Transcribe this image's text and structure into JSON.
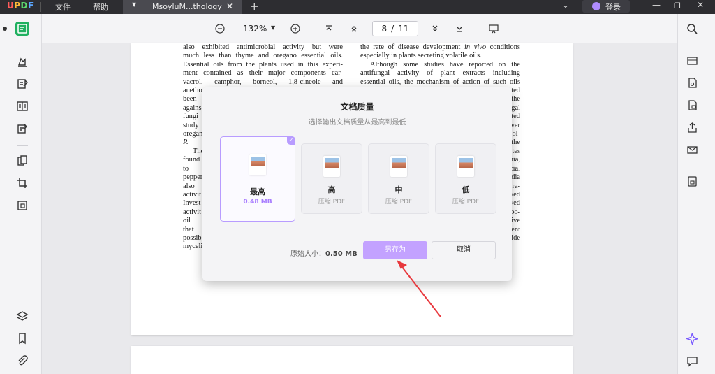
{
  "app": {
    "logo": "UPDF",
    "menu": [
      "文件",
      "帮助"
    ],
    "tab_name": "MsoyluM...thology",
    "login_label": "登录"
  },
  "toolbar": {
    "zoom": "132%",
    "current_page": "8",
    "page_separator": "/",
    "total_pages": "11"
  },
  "document": {
    "left_column": [
      "also exhibited antimicrobial activity but were",
      "much less than thyme and oregano essential oils.",
      "Essential oils from the plants used in this experi-",
      "ment contained as their major components car-",
      "vacrol, camphor, borneol, 1,8-cineole and",
      "anetho",
      "been",
      "agains",
      "fungi a",
      "study",
      "oregan",
      "P. infe",
      "The",
      "found",
      "to the",
      "pepper",
      "also",
      "activit",
      "Invest",
      "activit",
      "oil va",
      "that th",
      "possib",
      "myceli"
    ],
    "right_column": [
      "the rate of disease development in vivo conditions",
      "especially in plants secreting volatile oils.",
      "Although some studies have reported on the",
      "antifungal activity of plant extracts including",
      "essential oils, the mechanism of action of such oils",
      "ted",
      "the",
      "gal",
      "ted",
      "ver",
      "ol-",
      "the",
      "tes",
      "nia,",
      "cial",
      "dia",
      "ra-",
      "ved",
      "ved",
      "bo-",
      "ive",
      "ent",
      "ide"
    ]
  },
  "dialog": {
    "title": "文档质量",
    "subtitle": "选择输出文档质量从最高到最低",
    "options": [
      {
        "label": "最高",
        "size": "0.48 MB",
        "selected": true
      },
      {
        "label": "高",
        "size": "压缩 PDF",
        "selected": false
      },
      {
        "label": "中",
        "size": "压缩 PDF",
        "selected": false
      },
      {
        "label": "低",
        "size": "压缩 PDF",
        "selected": false
      }
    ],
    "original_size_label": "原始大小：",
    "original_size_value": "0.50 MB",
    "save_as_label": "另存为",
    "cancel_label": "取消"
  },
  "colors": {
    "accent": "#b89cff",
    "save_button": "#c3a2ff",
    "annotation_arrow": "#e8383d",
    "active_tool": "#20b060"
  }
}
